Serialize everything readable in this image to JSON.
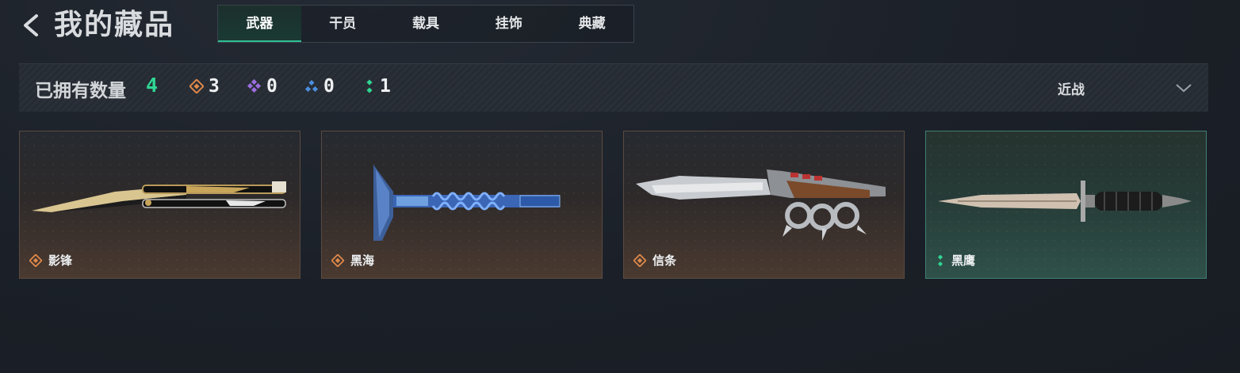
{
  "header": {
    "title": "我的藏品",
    "tabs": [
      {
        "label": "武器",
        "active": true
      },
      {
        "label": "干员",
        "active": false
      },
      {
        "label": "载具",
        "active": false
      },
      {
        "label": "挂饰",
        "active": false
      },
      {
        "label": "典藏",
        "active": false
      }
    ]
  },
  "stats": {
    "owned_label": "已拥有数量",
    "owned_count": "4",
    "rarities": [
      {
        "icon": "orange-diamond-icon",
        "color": "#e0894a",
        "count": "3"
      },
      {
        "icon": "purple-diamond-icon",
        "color": "#9b6ee0",
        "count": "0"
      },
      {
        "icon": "blue-diamond-icon",
        "color": "#4a8fe0",
        "count": "0"
      },
      {
        "icon": "green-diamond-icon",
        "color": "#2fd693",
        "count": "1"
      }
    ],
    "filter": {
      "label": "近战",
      "icon": "chevron-down-icon"
    }
  },
  "items": [
    {
      "name": "影锋",
      "rarity": "orange",
      "color": "#e0894a"
    },
    {
      "name": "黑海",
      "rarity": "orange",
      "color": "#e0894a"
    },
    {
      "name": "信条",
      "rarity": "orange",
      "color": "#e0894a"
    },
    {
      "name": "黑鹰",
      "rarity": "green",
      "color": "#2fd693"
    }
  ],
  "colors": {
    "accent": "#2fd693",
    "tab_active": "#2fbf93"
  }
}
